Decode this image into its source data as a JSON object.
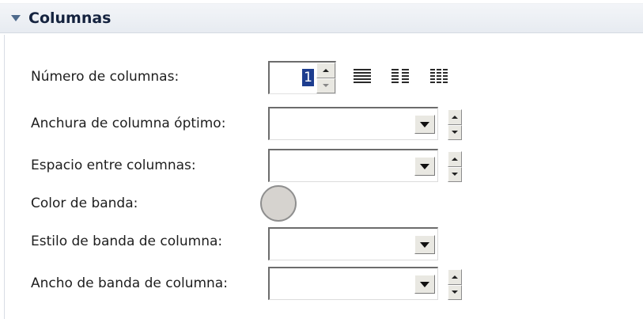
{
  "section": {
    "title": "Columnas",
    "collapse_icon": "triangle-down-icon"
  },
  "columns_count": {
    "label": "Número de columnas:",
    "value": "1",
    "layouts": [
      "one-column-layout-icon",
      "two-column-layout-icon",
      "three-column-layout-icon"
    ]
  },
  "optimal_width": {
    "label": "Anchura de columna óptimo:",
    "value": ""
  },
  "column_spacing": {
    "label": "Espacio entre columnas:",
    "value": ""
  },
  "band_color": {
    "label": "Color de banda:",
    "color": "#d6d3cf"
  },
  "band_style": {
    "label": "Estilo de banda de columna:",
    "value": ""
  },
  "band_width": {
    "label": "Ancho de banda de columna:",
    "value": ""
  }
}
